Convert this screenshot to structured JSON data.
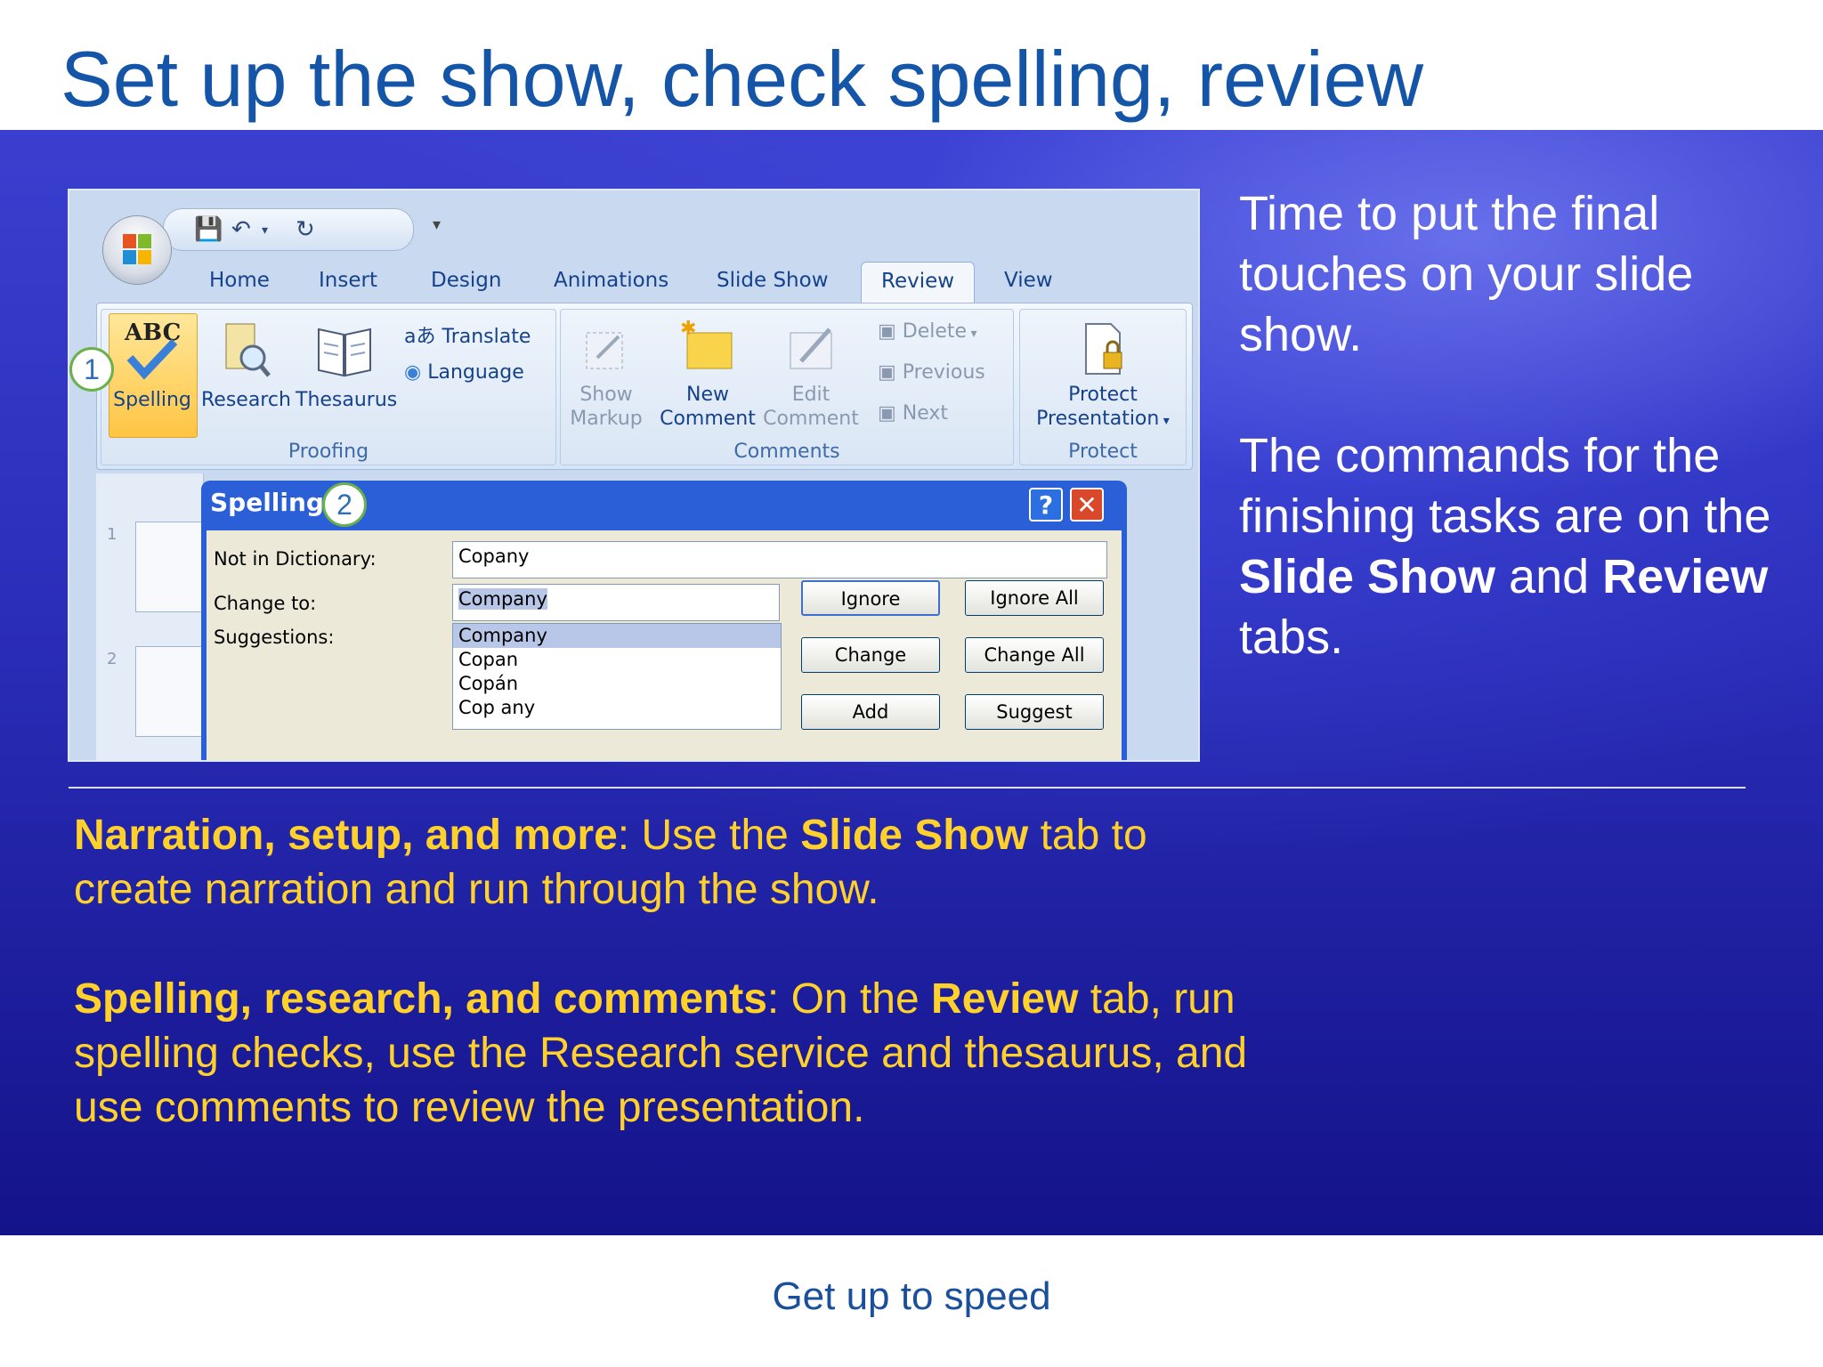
{
  "slide": {
    "title": "Set up the show, check spelling, review",
    "footer": "Get up to speed",
    "right_text": {
      "p1": "Time to put the final touches on your slide show.",
      "p2_a": "The commands for the finishing tasks are on the ",
      "p2_b": "Slide Show",
      "p2_c": " and ",
      "p2_d": "Review",
      "p2_e": " tabs."
    },
    "bullets": [
      {
        "bold": "Narration, setup, and more",
        "t1": ": Use the ",
        "b2": "Slide Show",
        "t2": " tab to create narration and run through the show."
      },
      {
        "bold": "Spelling, research, and comments",
        "t1": ": On the ",
        "b2": "Review",
        "t2": " tab, run spelling checks, use the Research service and thesaurus, and use comments to review the presentation."
      }
    ],
    "colors": {
      "title": "#1555a8",
      "highlight": "#ffd12a",
      "panel": "#2a2db8"
    }
  },
  "screenshot": {
    "tabs": [
      "Home",
      "Insert",
      "Design",
      "Animations",
      "Slide Show",
      "Review",
      "View"
    ],
    "active_tab": "Review",
    "groups": {
      "proofing": {
        "label": "Proofing",
        "spelling": "Spelling",
        "research": "Research",
        "thesaurus": "Thesaurus",
        "translate": "Translate",
        "language": "Language"
      },
      "comments": {
        "label": "Comments",
        "show_markup_1": "Show",
        "show_markup_2": "Markup",
        "new_1": "New",
        "new_2": "Comment",
        "edit_1": "Edit",
        "edit_2": "Comment",
        "delete": "Delete",
        "previous": "Previous",
        "next": "Next"
      },
      "protect": {
        "label": "Protect",
        "protect_1": "Protect",
        "protect_2": "Presentation"
      }
    },
    "callouts": [
      "1",
      "2"
    ],
    "thumb_numbers": [
      "1",
      "2"
    ],
    "spelling_dialog": {
      "title": "Spelling",
      "not_in_dict_label": "Not in Dictionary:",
      "not_in_dict_value": "Copany",
      "change_to_label": "Change to:",
      "change_to_value": "Company",
      "suggestions_label": "Suggestions:",
      "suggestions": [
        "Company",
        "Copan",
        "Copán",
        "Cop any"
      ],
      "buttons": {
        "ignore": "Ignore",
        "ignore_all": "Ignore All",
        "change": "Change",
        "change_all": "Change All",
        "add": "Add",
        "suggest": "Suggest"
      },
      "help": "?",
      "close": "✕"
    }
  }
}
